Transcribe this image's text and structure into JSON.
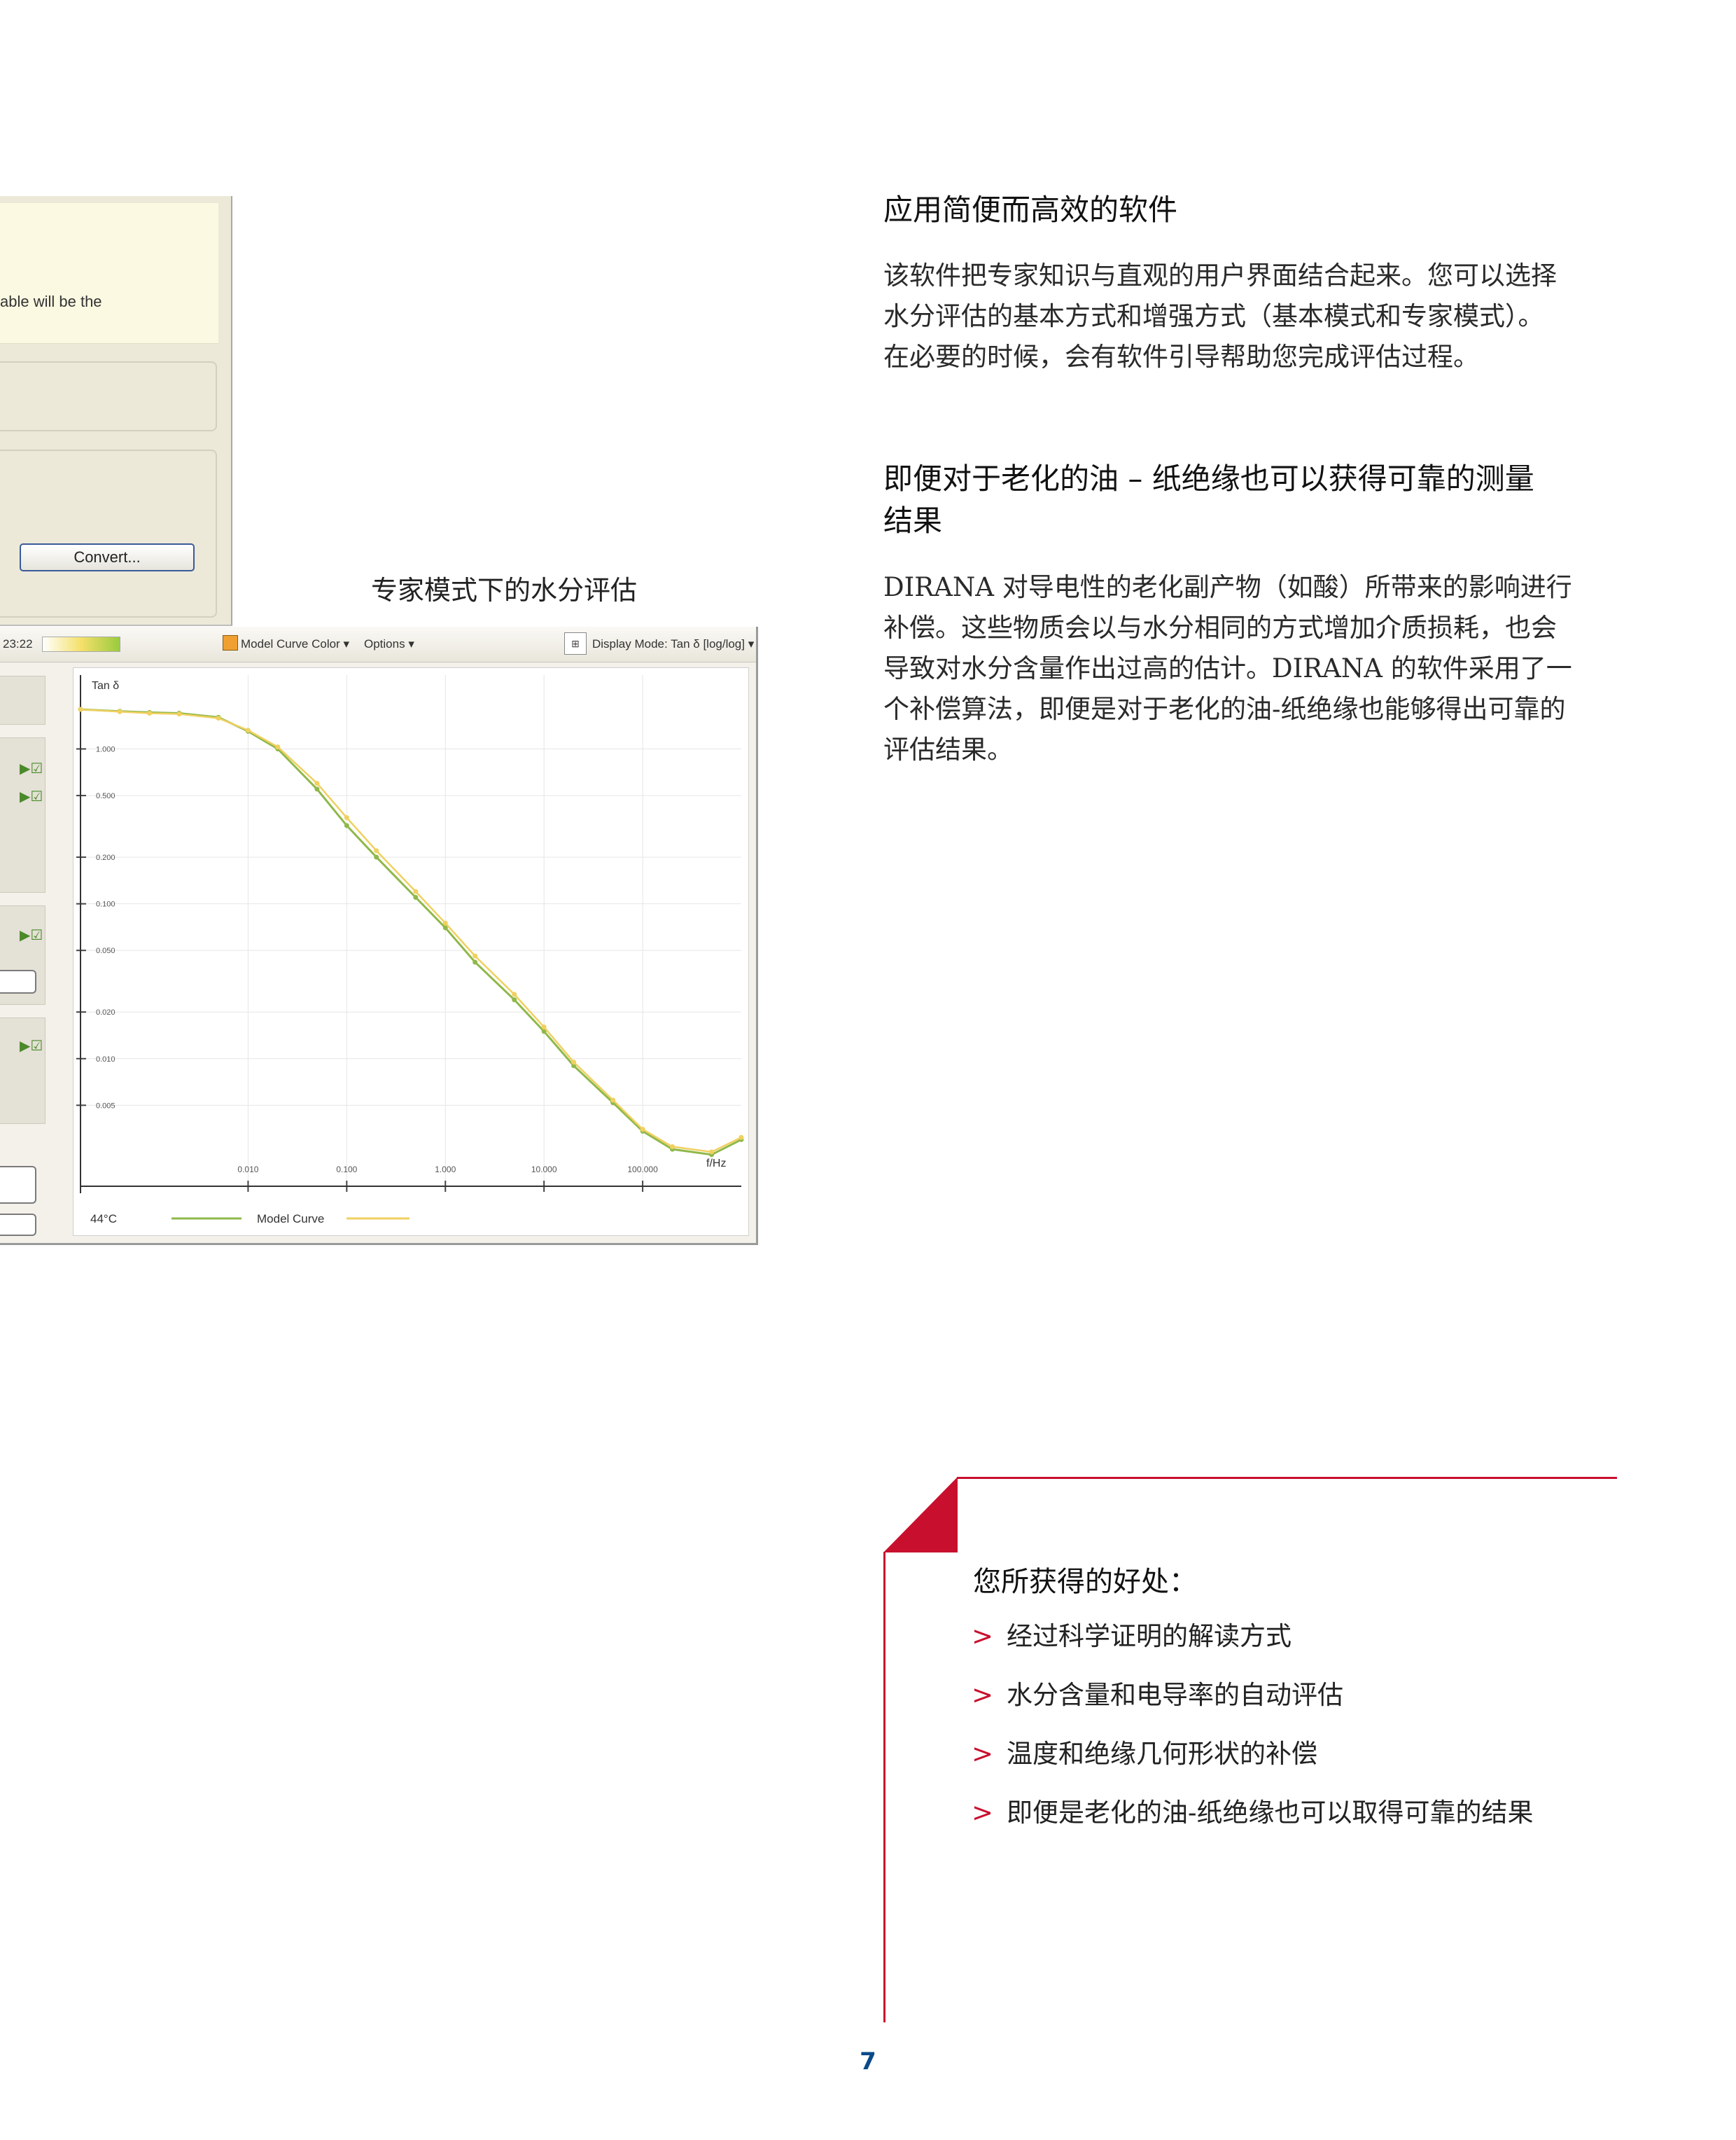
{
  "screenshot": {
    "dialog": {
      "note_text": "able will be the",
      "convert_label": "Convert..."
    },
    "toolbar": {
      "time": "23:22",
      "model_curve_color": "Model Curve Color",
      "options": "Options",
      "display_mode": "Display Mode: Tan δ [log/log]"
    },
    "colors": {
      "measured": "#8fb84a",
      "model": "#f0d060",
      "swatch": "#f0a030"
    }
  },
  "caption": "专家模式下的水分评估",
  "section1": {
    "heading": "应用简便而高效的软件",
    "lines": [
      "该软件把专家知识与直观的用户界面结合起来。您可以选择",
      "水分评估的基本方式和增强方式（基本模式和专家模式）。",
      "在必要的时候，会有软件引导帮助您完成评估过程。"
    ]
  },
  "section2": {
    "heading_lines": [
      "即便对于老化的油 – 纸绝缘也可以获得可靠的测量",
      "结果"
    ],
    "lines": [
      "DIRANA 对导电性的老化副产物（如酸）所带来的影响进行",
      "补偿。这些物质会以与水分相同的方式增加介质损耗，也会",
      "导致对水分含量作出过高的估计。DIRANA 的软件采用了一",
      "个补偿算法，即便是对于老化的油-纸绝缘也能够得出可靠的",
      "评估结果。"
    ]
  },
  "benefits": {
    "title": "您所获得的好处：",
    "marker": ">",
    "items": [
      "经过科学证明的解读方式",
      "水分含量和电导率的自动评估",
      "温度和绝缘几何形状的补偿",
      "即便是老化的油-纸绝缘也可以取得可靠的结果"
    ]
  },
  "page_number": "7",
  "chart_data": {
    "type": "line",
    "ylabel": "Tan δ",
    "xlabel": "f/Hz",
    "x_scale": "log",
    "y_scale": "log",
    "x_ticks": [
      "0.010",
      "0.100",
      "1.000",
      "10.000",
      "100.000"
    ],
    "y_ticks": [
      "1.000",
      "0.500",
      "0.200",
      "0.100",
      "0.050",
      "0.020",
      "0.010",
      "0.005"
    ],
    "xlim": [
      0.0002,
      1000
    ],
    "ylim": [
      0.0015,
      3
    ],
    "legend": {
      "temperature": "44°C",
      "model_label": "Model Curve"
    },
    "x": [
      0.0002,
      0.0005,
      0.001,
      0.002,
      0.005,
      0.01,
      0.02,
      0.05,
      0.1,
      0.2,
      0.5,
      1,
      2,
      5,
      10,
      20,
      50,
      100,
      200,
      500,
      1000
    ],
    "series": [
      {
        "values": [
          1.8,
          1.75,
          1.72,
          1.7,
          1.6,
          1.3,
          1.0,
          0.55,
          0.32,
          0.2,
          0.11,
          0.07,
          0.042,
          0.024,
          0.015,
          0.009,
          0.0052,
          0.0034,
          0.0026,
          0.0024,
          0.003
        ]
      },
      {
        "values": [
          1.8,
          1.74,
          1.7,
          1.68,
          1.58,
          1.32,
          1.03,
          0.6,
          0.36,
          0.22,
          0.12,
          0.075,
          0.046,
          0.026,
          0.016,
          0.0095,
          0.0054,
          0.0035,
          0.0027,
          0.0025,
          0.0031
        ]
      }
    ]
  }
}
